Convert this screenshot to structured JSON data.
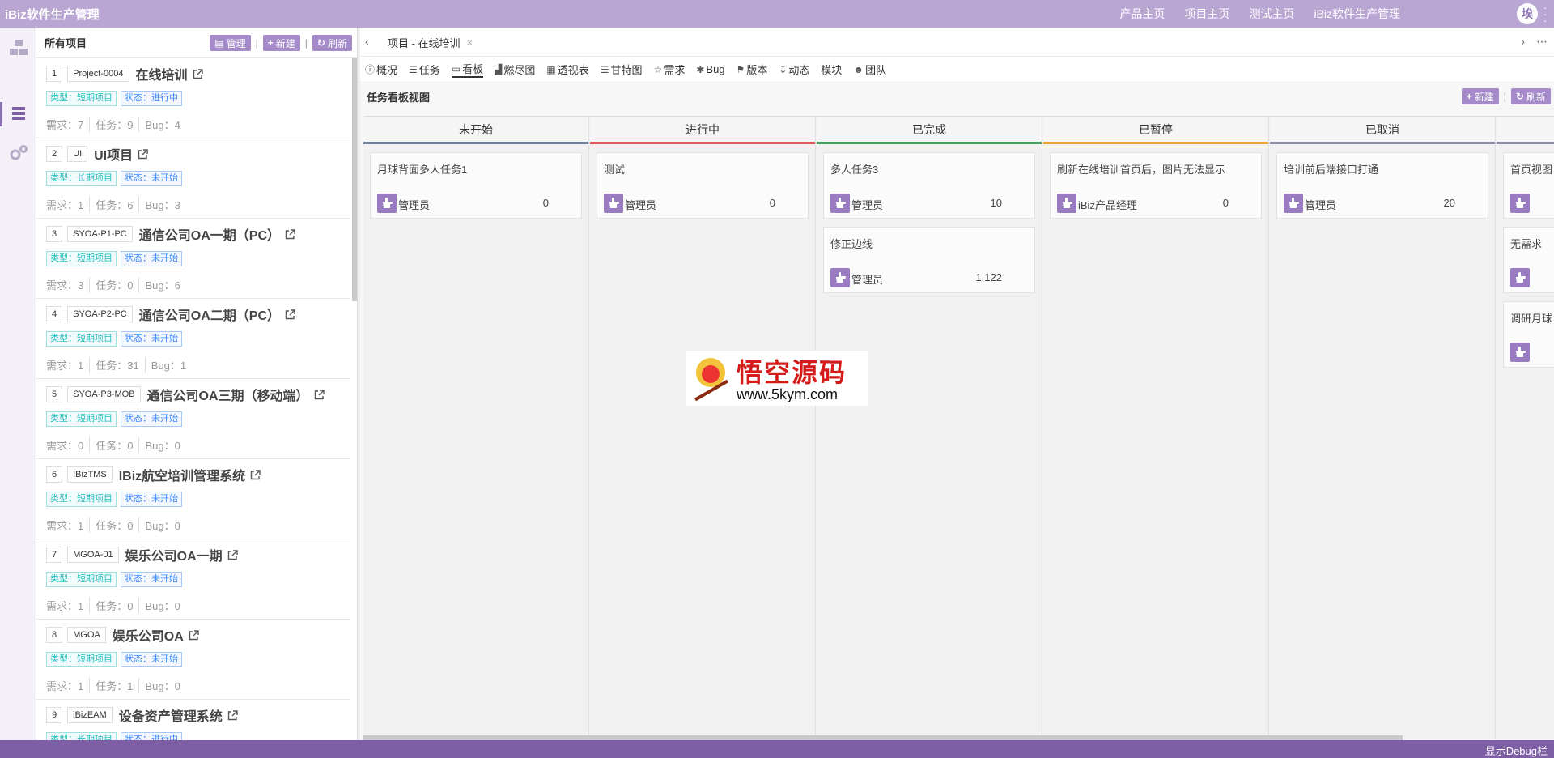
{
  "app_title": "iBiz软件生产管理",
  "top_nav": [
    "产品主页",
    "项目主页",
    "测试主页",
    "iBiz软件生产管理"
  ],
  "user_avatar": "埃",
  "sidebar_list": {
    "title": "所有项目",
    "btn_manage": "管理",
    "btn_new": "新建",
    "btn_refresh": "刷新",
    "items": [
      {
        "num": "1",
        "code": "Project-0004",
        "name": "在线培训",
        "type": "类型：短期项目",
        "status": "状态：进行中",
        "req": "需求：7",
        "task": "任务：9",
        "bug": "Bug：4"
      },
      {
        "num": "2",
        "code": "UI",
        "name": "UI项目",
        "type": "类型：长期项目",
        "status": "状态：未开始",
        "req": "需求：1",
        "task": "任务：6",
        "bug": "Bug：3"
      },
      {
        "num": "3",
        "code": "SYOA-P1-PC",
        "name": "通信公司OA一期（PC）",
        "type": "类型：短期项目",
        "status": "状态：未开始",
        "req": "需求：3",
        "task": "任务：0",
        "bug": "Bug：6"
      },
      {
        "num": "4",
        "code": "SYOA-P2-PC",
        "name": "通信公司OA二期（PC）",
        "type": "类型：短期项目",
        "status": "状态：未开始",
        "req": "需求：1",
        "task": "任务：31",
        "bug": "Bug：1"
      },
      {
        "num": "5",
        "code": "SYOA-P3-MOB",
        "name": "通信公司OA三期（移动端）",
        "type": "类型：短期项目",
        "status": "状态：未开始",
        "req": "需求：0",
        "task": "任务：0",
        "bug": "Bug：0"
      },
      {
        "num": "6",
        "code": "IBizTMS",
        "name": "IBiz航空培训管理系统",
        "type": "类型：短期项目",
        "status": "状态：未开始",
        "req": "需求：1",
        "task": "任务：0",
        "bug": "Bug：0"
      },
      {
        "num": "7",
        "code": "MGOA-01",
        "name": "娱乐公司OA一期",
        "type": "类型：短期项目",
        "status": "状态：未开始",
        "req": "需求：1",
        "task": "任务：0",
        "bug": "Bug：0"
      },
      {
        "num": "8",
        "code": "MGOA",
        "name": "娱乐公司OA",
        "type": "类型：短期项目",
        "status": "状态：未开始",
        "req": "需求：1",
        "task": "任务：1",
        "bug": "Bug：0"
      },
      {
        "num": "9",
        "code": "iBizEAM",
        "name": "设备资产管理系统",
        "type": "类型：长期项目",
        "status": "状态：进行中",
        "req": "",
        "task": "",
        "bug": ""
      }
    ]
  },
  "tab": {
    "label": "项目 - 在线培训"
  },
  "subnav": [
    {
      "glyph": "ⓘ",
      "label": "概况"
    },
    {
      "glyph": "☰",
      "label": "任务"
    },
    {
      "glyph": "▭",
      "label": "看板"
    },
    {
      "glyph": "▟",
      "label": "燃尽图"
    },
    {
      "glyph": "▦",
      "label": "透视表"
    },
    {
      "glyph": "☰",
      "label": "甘特图"
    },
    {
      "glyph": "☆",
      "label": "需求"
    },
    {
      "glyph": "✱",
      "label": "Bug"
    },
    {
      "glyph": "⚑",
      "label": "版本"
    },
    {
      "glyph": "↧",
      "label": "动态"
    },
    {
      "glyph": "",
      "label": "模块"
    },
    {
      "glyph": "☻",
      "label": "团队"
    }
  ],
  "view": {
    "title": "任务看板视图",
    "btn_new": "新建",
    "btn_refresh": "刷新"
  },
  "board": {
    "columns": [
      {
        "title": "未开始",
        "color": "#6e7fa0",
        "cards": [
          {
            "title": "月球背面多人任务1",
            "user": "管理员",
            "value": "0"
          }
        ]
      },
      {
        "title": "进行中",
        "color": "#e45a5a",
        "cards": [
          {
            "title": "测试",
            "user": "管理员",
            "value": "0"
          }
        ]
      },
      {
        "title": "已完成",
        "color": "#3fa35b",
        "cards": [
          {
            "title": "多人任务3",
            "user": "管理员",
            "value": "10"
          },
          {
            "title": "修正边线",
            "user": "管理员",
            "value": "1.122"
          }
        ]
      },
      {
        "title": "已暂停",
        "color": "#f0a030",
        "cards": [
          {
            "title": "刷新在线培训首页后，图片无法显示",
            "user": "iBiz产品经理",
            "value": "0"
          }
        ]
      },
      {
        "title": "已取消",
        "color": "#8d8fa8",
        "cards": [
          {
            "title": "培训前后端接口打通",
            "user": "管理员",
            "value": "20"
          }
        ]
      },
      {
        "title": "",
        "color": "#8d8fa8",
        "cards": [
          {
            "title": "首页视图",
            "user": "",
            "value": ""
          },
          {
            "title": "无需求",
            "user": "",
            "value": ""
          },
          {
            "title": "调研月球",
            "user": "",
            "value": ""
          }
        ]
      }
    ]
  },
  "watermark": {
    "text": "悟空源码",
    "url": "www.5kym.com"
  },
  "statusbar": {
    "label": "显示Debug栏"
  }
}
